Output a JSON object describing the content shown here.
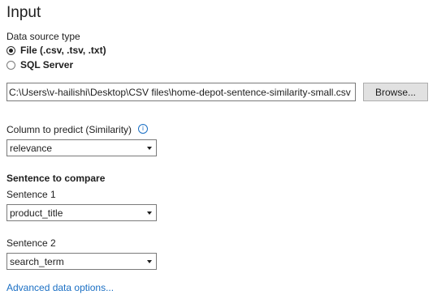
{
  "section_title": "Input",
  "data_source": {
    "label": "Data source type",
    "options": [
      {
        "label": "File (.csv, .tsv, .txt)",
        "selected": true
      },
      {
        "label": "SQL Server",
        "selected": false
      }
    ]
  },
  "file": {
    "path_value": "C:\\Users\\v-hailishi\\Desktop\\CSV files\\home-depot-sentence-similarity-small.csv",
    "browse_label": "Browse..."
  },
  "column_to_predict": {
    "label": "Column to predict (Similarity)",
    "info_icon": "info-icon",
    "selected_value": "relevance"
  },
  "sentence_compare": {
    "heading": "Sentence to compare",
    "sentence1_label": "Sentence 1",
    "sentence1_value": "product_title",
    "sentence2_label": "Sentence 2",
    "sentence2_value": "search_term"
  },
  "advanced_link": "Advanced data options...",
  "colors": {
    "link": "#1a6fc4",
    "text": "#1e1e1e",
    "button_bg": "#e1e1e1"
  }
}
